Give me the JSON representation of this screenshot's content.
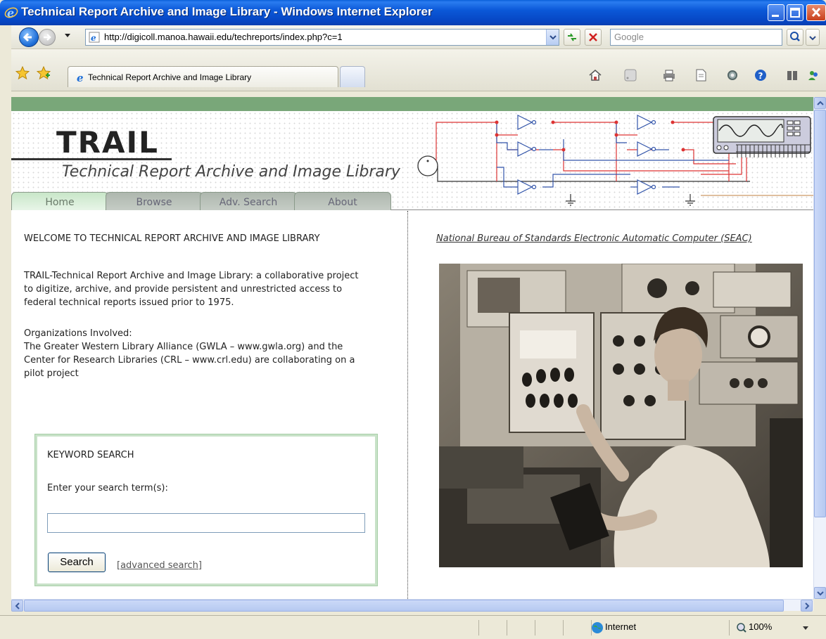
{
  "window": {
    "title": "Technical Report Archive and Image Library - Windows Internet Explorer"
  },
  "toolbar": {
    "url": "http://digicoll.manoa.hawaii.edu/techreports/index.php?c=1",
    "search_placeholder": "Google"
  },
  "tabs": {
    "active_label": "Technical Report Archive and Image Library"
  },
  "site": {
    "logo": "TRAIL",
    "subtitle": "Technical Report Archive and Image Library",
    "nav": [
      "Home",
      "Browse",
      "Adv. Search",
      "About"
    ],
    "welcome_heading": "WELCOME TO TECHNICAL REPORT ARCHIVE AND IMAGE LIBRARY",
    "intro": "TRAIL-Technical Report Archive and Image Library: a collaborative project to digitize, archive, and provide persistent and unrestricted access to federal technical reports issued prior to 1975.",
    "orgs_heading": "Organizations Involved:",
    "orgs_text": "The Greater Western Library Alliance (GWLA – www.gwla.org) and the Center for Research Libraries (CRL – www.crl.edu) are collaborating on a pilot project",
    "search": {
      "title": "KEYWORD SEARCH",
      "label": "Enter your search term(s):",
      "value": "",
      "button": "Search",
      "advanced_link": "[advanced search]"
    },
    "photo_caption": "National Bureau of Standards Electronic Automatic Computer (SEAC)"
  },
  "statusbar": {
    "zone": "Internet",
    "zoom": "100%"
  }
}
